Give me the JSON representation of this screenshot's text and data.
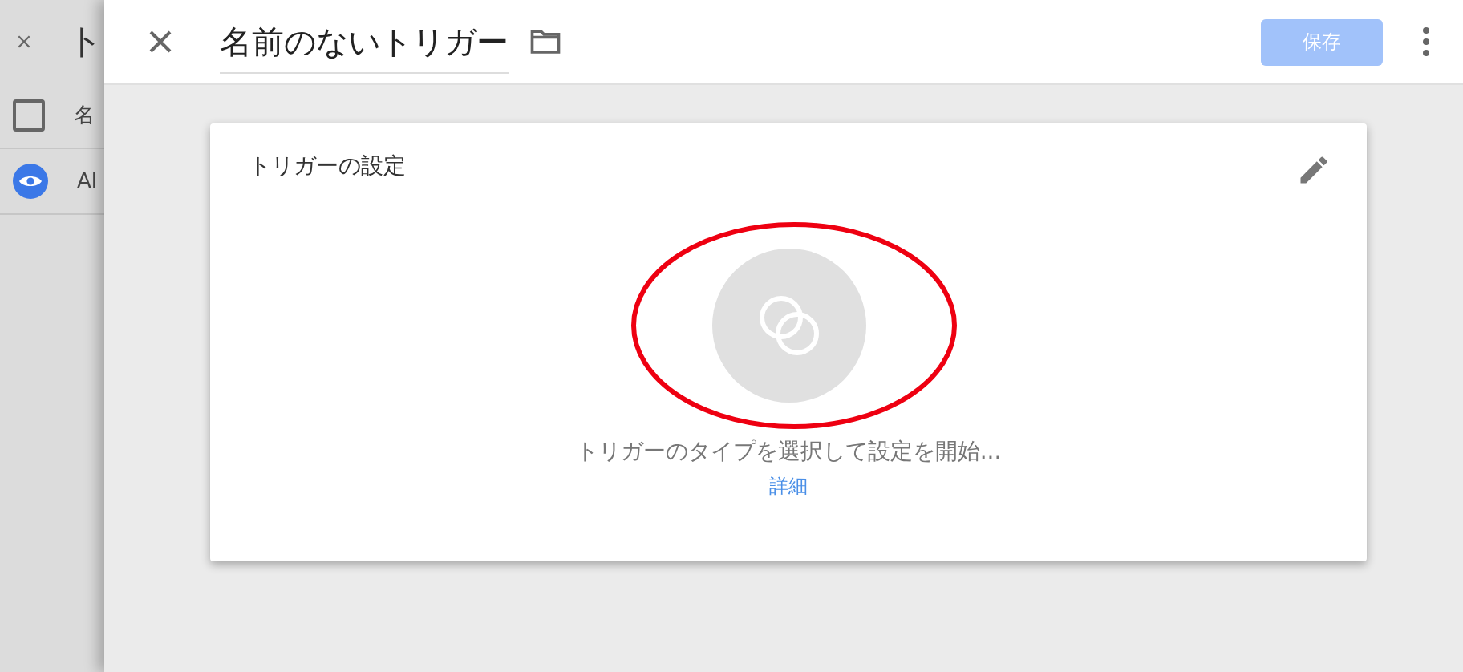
{
  "background_page": {
    "title": "ト",
    "header_checkbox": {
      "checked": false
    },
    "header_label": "名",
    "row_label": "Al"
  },
  "editor": {
    "title": "名前のないトリガー",
    "save_button": {
      "label": "保存",
      "disabled": true
    }
  },
  "card": {
    "title": "トリガーの設定",
    "prompt": "トリガーのタイプを選択して設定を開始...",
    "link": "詳細"
  }
}
